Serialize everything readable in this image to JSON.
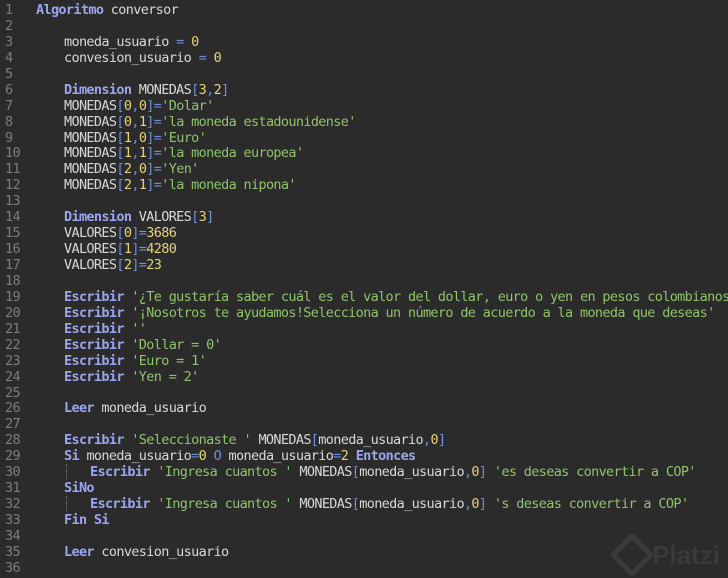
{
  "editor": {
    "colors": {
      "background": "#2b2b2b",
      "keyword": "#9aa6f0",
      "string": "#8fc46a",
      "number": "#e6d37a",
      "operator": "#6f8fd8",
      "identifier": "#d8d8d8",
      "line_number": "#7d7d7d"
    },
    "lines": [
      {
        "n": "1",
        "indent": 0,
        "tokens": [
          [
            "kw",
            "Algoritmo"
          ],
          [
            "id",
            " conversor"
          ]
        ]
      },
      {
        "n": "2",
        "indent": 0,
        "tokens": []
      },
      {
        "n": "3",
        "indent": 1,
        "tokens": [
          [
            "id",
            "moneda_usuario "
          ],
          [
            "op",
            "="
          ],
          [
            "id",
            " "
          ],
          [
            "num",
            "0"
          ]
        ]
      },
      {
        "n": "4",
        "indent": 1,
        "tokens": [
          [
            "id",
            "convesion_usuario "
          ],
          [
            "op",
            "="
          ],
          [
            "id",
            " "
          ],
          [
            "num",
            "0"
          ]
        ]
      },
      {
        "n": "5",
        "indent": 0,
        "tokens": []
      },
      {
        "n": "6",
        "indent": 1,
        "tokens": [
          [
            "kw",
            "Dimension"
          ],
          [
            "id",
            " MONEDAS"
          ],
          [
            "op",
            "["
          ],
          [
            "num",
            "3"
          ],
          [
            "op",
            ","
          ],
          [
            "num",
            "2"
          ],
          [
            "op",
            "]"
          ]
        ]
      },
      {
        "n": "7",
        "indent": 1,
        "tokens": [
          [
            "id",
            "MONEDAS"
          ],
          [
            "op",
            "["
          ],
          [
            "num",
            "0"
          ],
          [
            "op",
            ","
          ],
          [
            "num",
            "0"
          ],
          [
            "op",
            "]="
          ],
          [
            "str",
            "'Dolar'"
          ]
        ]
      },
      {
        "n": "8",
        "indent": 1,
        "tokens": [
          [
            "id",
            "MONEDAS"
          ],
          [
            "op",
            "["
          ],
          [
            "num",
            "0"
          ],
          [
            "op",
            ","
          ],
          [
            "num",
            "1"
          ],
          [
            "op",
            "]="
          ],
          [
            "str",
            "'la moneda estadounidense'"
          ]
        ]
      },
      {
        "n": "9",
        "indent": 1,
        "tokens": [
          [
            "id",
            "MONEDAS"
          ],
          [
            "op",
            "["
          ],
          [
            "num",
            "1"
          ],
          [
            "op",
            ","
          ],
          [
            "num",
            "0"
          ],
          [
            "op",
            "]="
          ],
          [
            "str",
            "'Euro'"
          ]
        ]
      },
      {
        "n": "10",
        "indent": 1,
        "tokens": [
          [
            "id",
            "MONEDAS"
          ],
          [
            "op",
            "["
          ],
          [
            "num",
            "1"
          ],
          [
            "op",
            ","
          ],
          [
            "num",
            "1"
          ],
          [
            "op",
            "]="
          ],
          [
            "str",
            "'la moneda europea'"
          ]
        ]
      },
      {
        "n": "11",
        "indent": 1,
        "tokens": [
          [
            "id",
            "MONEDAS"
          ],
          [
            "op",
            "["
          ],
          [
            "num",
            "2"
          ],
          [
            "op",
            ","
          ],
          [
            "num",
            "0"
          ],
          [
            "op",
            "]="
          ],
          [
            "str",
            "'Yen'"
          ]
        ]
      },
      {
        "n": "12",
        "indent": 1,
        "tokens": [
          [
            "id",
            "MONEDAS"
          ],
          [
            "op",
            "["
          ],
          [
            "num",
            "2"
          ],
          [
            "op",
            ","
          ],
          [
            "num",
            "1"
          ],
          [
            "op",
            "]="
          ],
          [
            "str",
            "'la moneda nipona'"
          ]
        ]
      },
      {
        "n": "13",
        "indent": 0,
        "tokens": []
      },
      {
        "n": "14",
        "indent": 1,
        "tokens": [
          [
            "kw",
            "Dimension"
          ],
          [
            "id",
            " VALORES"
          ],
          [
            "op",
            "["
          ],
          [
            "num",
            "3"
          ],
          [
            "op",
            "]"
          ]
        ]
      },
      {
        "n": "15",
        "indent": 1,
        "tokens": [
          [
            "id",
            "VALORES"
          ],
          [
            "op",
            "["
          ],
          [
            "num",
            "0"
          ],
          [
            "op",
            "]="
          ],
          [
            "num",
            "3686"
          ]
        ]
      },
      {
        "n": "16",
        "indent": 1,
        "tokens": [
          [
            "id",
            "VALORES"
          ],
          [
            "op",
            "["
          ],
          [
            "num",
            "1"
          ],
          [
            "op",
            "]="
          ],
          [
            "num",
            "4280"
          ]
        ]
      },
      {
        "n": "17",
        "indent": 1,
        "tokens": [
          [
            "id",
            "VALORES"
          ],
          [
            "op",
            "["
          ],
          [
            "num",
            "2"
          ],
          [
            "op",
            "]="
          ],
          [
            "num",
            "23"
          ]
        ]
      },
      {
        "n": "18",
        "indent": 0,
        "tokens": []
      },
      {
        "n": "19",
        "indent": 1,
        "tokens": [
          [
            "kw",
            "Escribir"
          ],
          [
            "id",
            " "
          ],
          [
            "str",
            "'¿Te gustaría saber cuál es el valor del dollar, euro o yen en pesos colombianos?'"
          ]
        ]
      },
      {
        "n": "20",
        "indent": 1,
        "tokens": [
          [
            "kw",
            "Escribir"
          ],
          [
            "id",
            " "
          ],
          [
            "str",
            "'¡Nosotros te ayudamos!Selecciona un número de acuerdo a la moneda que deseas'"
          ]
        ]
      },
      {
        "n": "21",
        "indent": 1,
        "tokens": [
          [
            "kw",
            "Escribir"
          ],
          [
            "id",
            " "
          ],
          [
            "str",
            "''"
          ]
        ]
      },
      {
        "n": "22",
        "indent": 1,
        "tokens": [
          [
            "kw",
            "Escribir"
          ],
          [
            "id",
            " "
          ],
          [
            "str",
            "'Dollar = 0'"
          ]
        ]
      },
      {
        "n": "23",
        "indent": 1,
        "tokens": [
          [
            "kw",
            "Escribir"
          ],
          [
            "id",
            " "
          ],
          [
            "str",
            "'Euro = 1'"
          ]
        ]
      },
      {
        "n": "24",
        "indent": 1,
        "tokens": [
          [
            "kw",
            "Escribir"
          ],
          [
            "id",
            " "
          ],
          [
            "str",
            "'Yen = 2'"
          ]
        ]
      },
      {
        "n": "25",
        "indent": 0,
        "tokens": []
      },
      {
        "n": "26",
        "indent": 1,
        "tokens": [
          [
            "kw",
            "Leer"
          ],
          [
            "id",
            " moneda_usuario"
          ]
        ]
      },
      {
        "n": "27",
        "indent": 0,
        "tokens": []
      },
      {
        "n": "28",
        "indent": 1,
        "tokens": [
          [
            "kw",
            "Escribir"
          ],
          [
            "id",
            " "
          ],
          [
            "str",
            "'Seleccionaste '"
          ],
          [
            "id",
            " MONEDAS"
          ],
          [
            "op",
            "["
          ],
          [
            "id",
            "moneda_usuario"
          ],
          [
            "op",
            ","
          ],
          [
            "num",
            "0"
          ],
          [
            "op",
            "]"
          ]
        ]
      },
      {
        "n": "29",
        "indent": 1,
        "tokens": [
          [
            "kw",
            "Si"
          ],
          [
            "id",
            " moneda_usuario"
          ],
          [
            "op",
            "="
          ],
          [
            "num",
            "0"
          ],
          [
            "id",
            " "
          ],
          [
            "op",
            "O"
          ],
          [
            "id",
            " moneda_usuario"
          ],
          [
            "op",
            "="
          ],
          [
            "num",
            "2"
          ],
          [
            "id",
            " "
          ],
          [
            "kw",
            "Entonces"
          ]
        ]
      },
      {
        "n": "30",
        "indent": 2,
        "guide": true,
        "tokens": [
          [
            "kw",
            "Escribir"
          ],
          [
            "id",
            " "
          ],
          [
            "str",
            "'Ingresa cuantos '"
          ],
          [
            "id",
            " MONEDAS"
          ],
          [
            "op",
            "["
          ],
          [
            "id",
            "moneda_usuario"
          ],
          [
            "op",
            ","
          ],
          [
            "num",
            "0"
          ],
          [
            "op",
            "]"
          ],
          [
            "id",
            " "
          ],
          [
            "str",
            "'es deseas convertir a COP'"
          ]
        ]
      },
      {
        "n": "31",
        "indent": 1,
        "tokens": [
          [
            "kw",
            "SiNo"
          ]
        ]
      },
      {
        "n": "32",
        "indent": 2,
        "guide": true,
        "tokens": [
          [
            "kw",
            "Escribir"
          ],
          [
            "id",
            " "
          ],
          [
            "str",
            "'Ingresa cuantos '"
          ],
          [
            "id",
            " MONEDAS"
          ],
          [
            "op",
            "["
          ],
          [
            "id",
            "moneda_usuario"
          ],
          [
            "op",
            ","
          ],
          [
            "num",
            "0"
          ],
          [
            "op",
            "]"
          ],
          [
            "id",
            " "
          ],
          [
            "str",
            "'s deseas convertir a COP'"
          ]
        ]
      },
      {
        "n": "33",
        "indent": 1,
        "tokens": [
          [
            "kw",
            "Fin Si"
          ]
        ]
      },
      {
        "n": "34",
        "indent": 0,
        "tokens": []
      },
      {
        "n": "35",
        "indent": 1,
        "tokens": [
          [
            "kw",
            "Leer"
          ],
          [
            "id",
            " convesion_usuario"
          ]
        ]
      },
      {
        "n": "36",
        "indent": 0,
        "tokens": []
      }
    ]
  },
  "watermark": {
    "text": "Platzi"
  }
}
